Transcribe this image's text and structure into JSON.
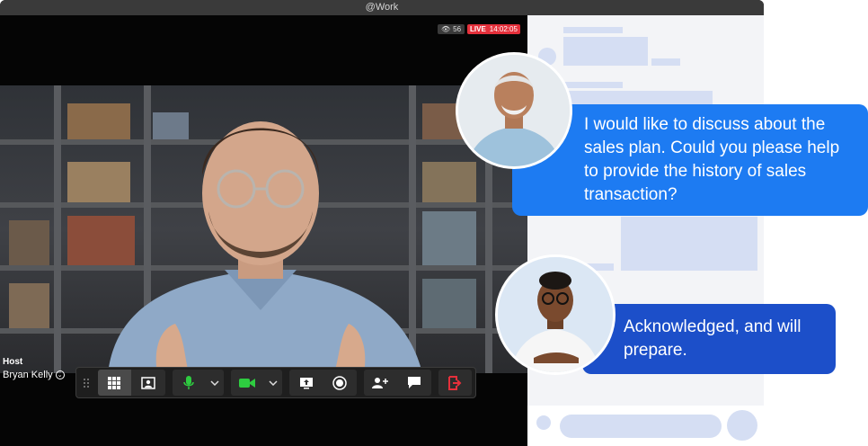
{
  "window": {
    "title": "@Work"
  },
  "stream": {
    "viewers": "56",
    "live_label": "LIVE",
    "live_time": "14:02:05"
  },
  "host": {
    "role": "Host",
    "name": "Bryan Kelly"
  },
  "toolbar": {
    "buttons": [
      {
        "name": "grid-view",
        "icon": "grid-icon"
      },
      {
        "name": "speaker-view",
        "icon": "person-frame-icon"
      },
      {
        "name": "mic",
        "icon": "microphone-icon",
        "color": "#2ecc40"
      },
      {
        "name": "camera",
        "icon": "video-camera-icon",
        "color": "#2ecc40"
      },
      {
        "name": "share-screen",
        "icon": "share-screen-icon"
      },
      {
        "name": "record",
        "icon": "record-icon"
      },
      {
        "name": "add-participant",
        "icon": "add-user-icon"
      },
      {
        "name": "chat",
        "icon": "chat-icon"
      },
      {
        "name": "leave",
        "icon": "exit-icon",
        "color": "#e5303b"
      }
    ]
  },
  "chat": {
    "messages": [
      {
        "text": "I would like to discuss about the sales plan. Could you please help to provide the history of sales transaction?",
        "color": "#1d7bf2"
      },
      {
        "text": "Acknowledged, and will prepare.",
        "color": "#1c4fc9"
      }
    ]
  },
  "colors": {
    "accent_blue": "#1d7bf2",
    "deep_blue": "#1c4fc9",
    "live_red": "#e5303b",
    "placeholder": "#d5def3"
  }
}
